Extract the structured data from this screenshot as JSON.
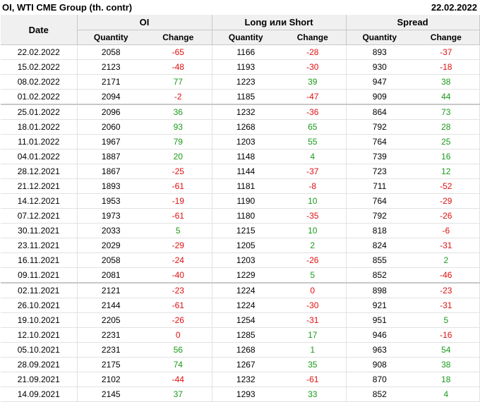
{
  "header": {
    "title": "OI, WTI CME Group (th. contr)",
    "date": "22.02.2022"
  },
  "columns": {
    "date": "Date",
    "groups": [
      "OI",
      "Long или Short",
      "Spread"
    ],
    "sub": [
      "Quantity",
      "Change",
      "Quantity",
      "Change",
      "Quantity",
      "Change"
    ]
  },
  "colors": {
    "positive": "#1a9a1a",
    "negative": "#e01010"
  },
  "rows": [
    {
      "date": "22.02.2022",
      "oi_q": "2058",
      "oi_c": "-65",
      "ls_q": "1166",
      "ls_c": "-28",
      "sp_q": "893",
      "sp_c": "-37"
    },
    {
      "date": "15.02.2022",
      "oi_q": "2123",
      "oi_c": "-48",
      "ls_q": "1193",
      "ls_c": "-30",
      "sp_q": "930",
      "sp_c": "-18"
    },
    {
      "date": "08.02.2022",
      "oi_q": "2171",
      "oi_c": "77",
      "ls_q": "1223",
      "ls_c": "39",
      "sp_q": "947",
      "sp_c": "38"
    },
    {
      "date": "01.02.2022",
      "oi_q": "2094",
      "oi_c": "-2",
      "ls_q": "1185",
      "ls_c": "-47",
      "sp_q": "909",
      "sp_c": "44"
    },
    {
      "date": "25.01.2022",
      "oi_q": "2096",
      "oi_c": "36",
      "ls_q": "1232",
      "ls_c": "-36",
      "sp_q": "864",
      "sp_c": "73"
    },
    {
      "date": "18.01.2022",
      "oi_q": "2060",
      "oi_c": "93",
      "ls_q": "1268",
      "ls_c": "65",
      "sp_q": "792",
      "sp_c": "28"
    },
    {
      "date": "11.01.2022",
      "oi_q": "1967",
      "oi_c": "79",
      "ls_q": "1203",
      "ls_c": "55",
      "sp_q": "764",
      "sp_c": "25"
    },
    {
      "date": "04.01.2022",
      "oi_q": "1887",
      "oi_c": "20",
      "ls_q": "1148",
      "ls_c": "4",
      "sp_q": "739",
      "sp_c": "16"
    },
    {
      "date": "28.12.2021",
      "oi_q": "1867",
      "oi_c": "-25",
      "ls_q": "1144",
      "ls_c": "-37",
      "sp_q": "723",
      "sp_c": "12"
    },
    {
      "date": "21.12.2021",
      "oi_q": "1893",
      "oi_c": "-61",
      "ls_q": "1181",
      "ls_c": "-8",
      "sp_q": "711",
      "sp_c": "-52"
    },
    {
      "date": "14.12.2021",
      "oi_q": "1953",
      "oi_c": "-19",
      "ls_q": "1190",
      "ls_c": "10",
      "sp_q": "764",
      "sp_c": "-29"
    },
    {
      "date": "07.12.2021",
      "oi_q": "1973",
      "oi_c": "-61",
      "ls_q": "1180",
      "ls_c": "-35",
      "sp_q": "792",
      "sp_c": "-26"
    },
    {
      "date": "30.11.2021",
      "oi_q": "2033",
      "oi_c": "5",
      "ls_q": "1215",
      "ls_c": "10",
      "sp_q": "818",
      "sp_c": "-6"
    },
    {
      "date": "23.11.2021",
      "oi_q": "2029",
      "oi_c": "-29",
      "ls_q": "1205",
      "ls_c": "2",
      "sp_q": "824",
      "sp_c": "-31"
    },
    {
      "date": "16.11.2021",
      "oi_q": "2058",
      "oi_c": "-24",
      "ls_q": "1203",
      "ls_c": "-26",
      "sp_q": "855",
      "sp_c": "2"
    },
    {
      "date": "09.11.2021",
      "oi_q": "2081",
      "oi_c": "-40",
      "ls_q": "1229",
      "ls_c": "5",
      "sp_q": "852",
      "sp_c": "-46"
    },
    {
      "date": "02.11.2021",
      "oi_q": "2121",
      "oi_c": "-23",
      "ls_q": "1224",
      "ls_c": "0",
      "sp_q": "898",
      "sp_c": "-23"
    },
    {
      "date": "26.10.2021",
      "oi_q": "2144",
      "oi_c": "-61",
      "ls_q": "1224",
      "ls_c": "-30",
      "sp_q": "921",
      "sp_c": "-31"
    },
    {
      "date": "19.10.2021",
      "oi_q": "2205",
      "oi_c": "-26",
      "ls_q": "1254",
      "ls_c": "-31",
      "sp_q": "951",
      "sp_c": "5"
    },
    {
      "date": "12.10.2021",
      "oi_q": "2231",
      "oi_c": "0",
      "ls_q": "1285",
      "ls_c": "17",
      "sp_q": "946",
      "sp_c": "-16"
    },
    {
      "date": "05.10.2021",
      "oi_q": "2231",
      "oi_c": "56",
      "ls_q": "1268",
      "ls_c": "1",
      "sp_q": "963",
      "sp_c": "54"
    },
    {
      "date": "28.09.2021",
      "oi_q": "2175",
      "oi_c": "74",
      "ls_q": "1267",
      "ls_c": "35",
      "sp_q": "908",
      "sp_c": "38"
    },
    {
      "date": "21.09.2021",
      "oi_q": "2102",
      "oi_c": "-44",
      "ls_q": "1232",
      "ls_c": "-61",
      "sp_q": "870",
      "sp_c": "18"
    },
    {
      "date": "14.09.2021",
      "oi_q": "2145",
      "oi_c": "37",
      "ls_q": "1293",
      "ls_c": "33",
      "sp_q": "852",
      "sp_c": "4"
    }
  ]
}
